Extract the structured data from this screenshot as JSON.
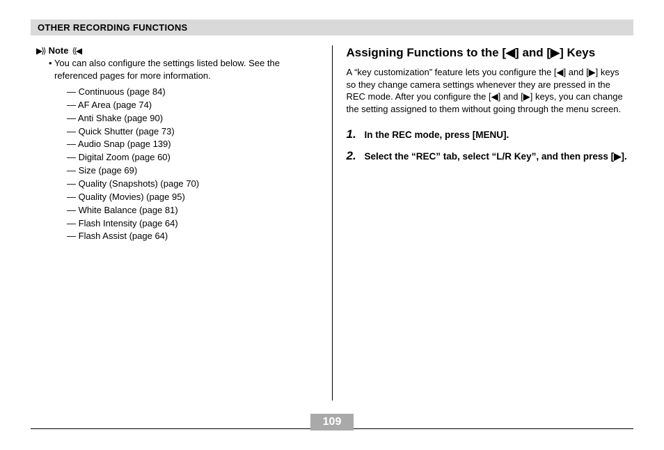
{
  "section_header": "OTHER RECORDING FUNCTIONS",
  "note": {
    "label": "Note",
    "icon_left": "▶⟩⟩",
    "icon_right": "⟨⟨◀",
    "text": "You can also configure the settings listed below. See the referenced pages for more information."
  },
  "settings": [
    "Continuous (page 84)",
    "AF Area (page 74)",
    "Anti Shake (page 90)",
    "Quick Shutter (page 73)",
    "Audio Snap (page 139)",
    "Digital Zoom (page 60)",
    "Size (page 69)",
    "Quality (Snapshots) (page 70)",
    "Quality (Movies) (page 95)",
    "White Balance (page 81)",
    "Flash Intensity (page 64)",
    "Flash Assist (page 64)"
  ],
  "right": {
    "heading": "Assigning Functions to the [◀] and [▶] Keys",
    "body": "A “key customization” feature lets you configure the [◀] and [▶] keys so they change camera settings whenever they are pressed in the REC mode. After you configure the [◀] and [▶] keys, you can change the setting assigned to them without going through the menu screen.",
    "steps": [
      {
        "num": "1.",
        "text": "In the REC mode, press [MENU]."
      },
      {
        "num": "2.",
        "text": "Select the “REC” tab, select “L/R Key”, and then press [▶]."
      }
    ]
  },
  "page_number": "109"
}
